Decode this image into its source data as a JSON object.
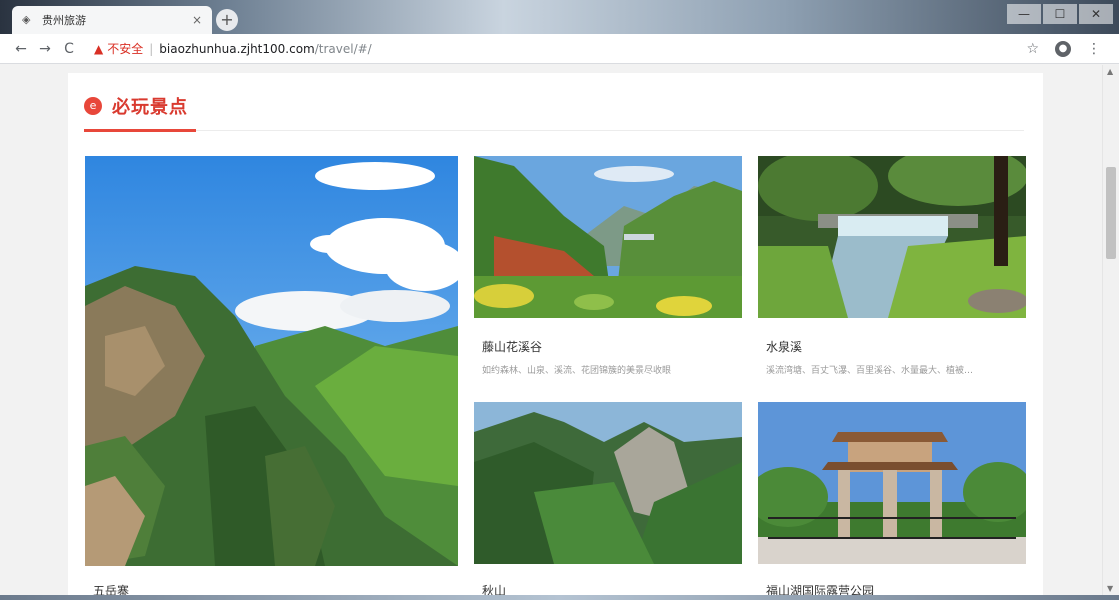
{
  "browser": {
    "tab_title": "贵州旅游",
    "tab_close": "×",
    "new_tab": "+",
    "security_warning": "不安全",
    "url_host": "biaozhunhua.zjht100.com",
    "url_path": "/travel/#/",
    "back": "←",
    "forward": "→",
    "reload": "C",
    "star": "☆",
    "profile": "●",
    "menu": "⋮",
    "win_min": "—",
    "win_max": "☐",
    "win_close": "✕"
  },
  "section": {
    "icon": "e",
    "title": "必玩景点"
  },
  "spots": [
    {
      "name": "五岳寨",
      "desc": ""
    },
    {
      "name": "藤山花溪谷",
      "desc": "如约森林、山泉、溪流、花团锦簇的美景尽收眼"
    },
    {
      "name": "水泉溪",
      "desc": "溪流湾塘、百丈飞瀑、百里溪谷、水量最大、植被…"
    },
    {
      "name": "秋山",
      "desc": ""
    },
    {
      "name": "福山湖国际露营公园",
      "desc": ""
    }
  ]
}
